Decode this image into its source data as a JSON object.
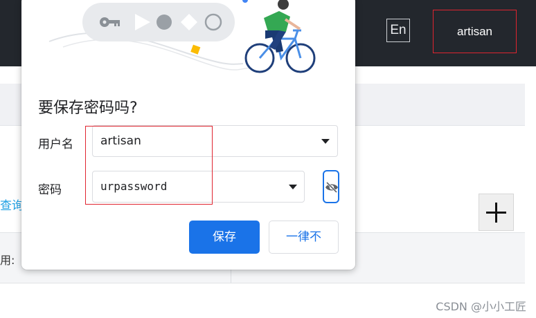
{
  "header": {
    "language_button": "En",
    "user_button": "artisan"
  },
  "background": {
    "query_link": "查询",
    "table_header_label": "用:",
    "add_button_icon": "plus-icon",
    "watermark": "CSDN @小小工匠"
  },
  "dialog": {
    "title": "要保存密码吗?",
    "username_label": "用户名",
    "username_value": "artisan",
    "password_label": "密码",
    "password_value": "urpassword",
    "toggle_visibility_icon": "eye-off-icon",
    "save_button": "保存",
    "never_button": "一律不"
  },
  "colors": {
    "accent": "#1a73e8",
    "topbar": "#23272d",
    "annotation": "#e0242f",
    "link": "#1fa0e3"
  }
}
